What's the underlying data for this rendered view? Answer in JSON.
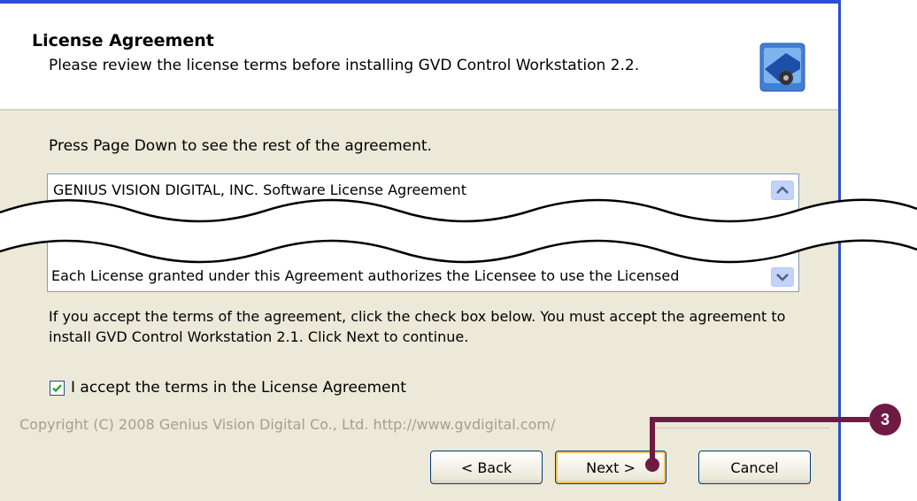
{
  "header": {
    "title": "License Agreement",
    "subtitle": "Please review the license terms before installing GVD Control Workstation 2.2."
  },
  "body": {
    "instruction": "Press Page Down to see the rest of the agreement.",
    "license_first_line": "GENIUS VISION DIGITAL, INC. Software License Agreement",
    "license_last_line": "Each License granted under this Agreement authorizes the Licensee to use the Licensed",
    "accept_instructions": "If you accept the terms of the agreement, click the check box below. You must accept the agreement to install GVD Control Workstation 2.1. Click Next to continue.",
    "checkbox_label": "I accept the terms in the License Agreement",
    "checkbox_checked": true
  },
  "footer": {
    "copyright": "Copyright (C) 2008 Genius Vision Digital Co., Ltd. http://www.gvdigital.com/",
    "back_label": "< Back",
    "next_label": "Next >",
    "cancel_label": "Cancel"
  },
  "callout": {
    "number": "3",
    "color": "#6e1a45"
  },
  "icons": {
    "header": "installer-logo-icon",
    "scroll_up": "chevron-up-icon",
    "scroll_down": "chevron-down-icon",
    "checkbox": "checkmark-icon"
  }
}
